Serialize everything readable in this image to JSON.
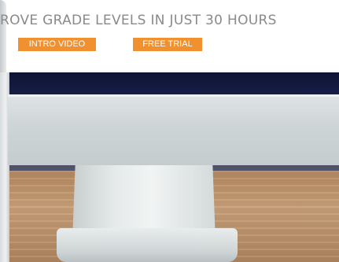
{
  "header": {
    "headline": "ROVE GRADE LEVELS IN JUST 30 HOURS"
  },
  "buttons": {
    "intro_label": "INTRO VIDEO",
    "trial_label": "FREE TRIAL"
  },
  "colors": {
    "accent": "#f0902e",
    "headline": "#8a8a8a",
    "background": "#ffffff"
  }
}
